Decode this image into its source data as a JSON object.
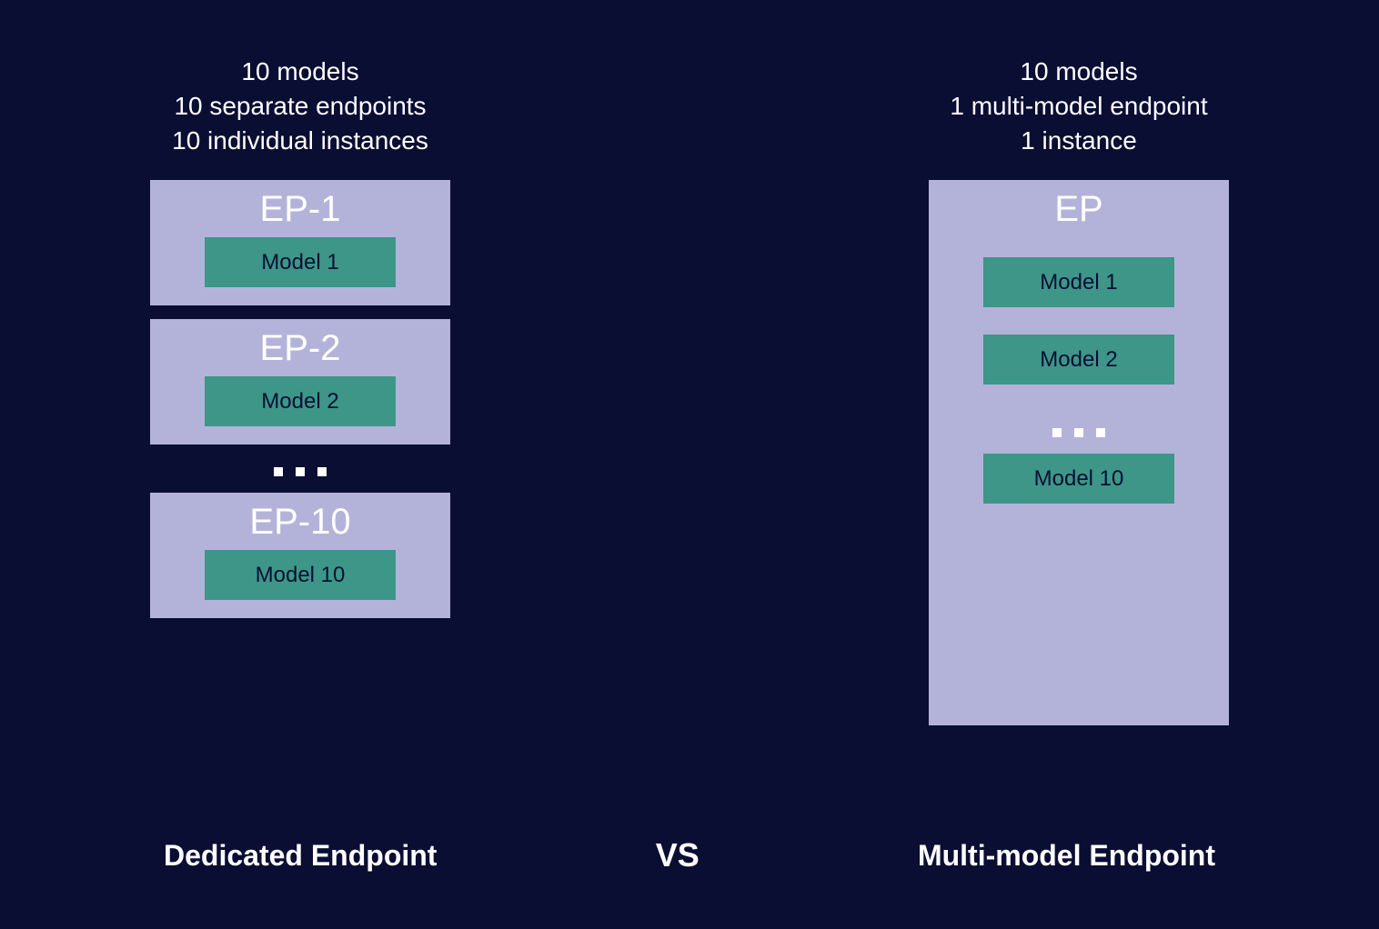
{
  "left": {
    "header": "10 models\n10 separate endpoints\n10 individual instances",
    "endpoints": [
      {
        "title": "EP-1",
        "model": "Model 1"
      },
      {
        "title": "EP-2",
        "model": "Model 2"
      },
      {
        "title": "EP-10",
        "model": "Model 10"
      }
    ],
    "footer": "Dedicated Endpoint"
  },
  "right": {
    "header": "10 models\n1 multi-model endpoint\n1 instance",
    "endpoint": {
      "title": "EP",
      "models": [
        "Model 1",
        "Model 2",
        "Model 10"
      ]
    },
    "footer": "Multi-model Endpoint"
  },
  "vs": "VS"
}
